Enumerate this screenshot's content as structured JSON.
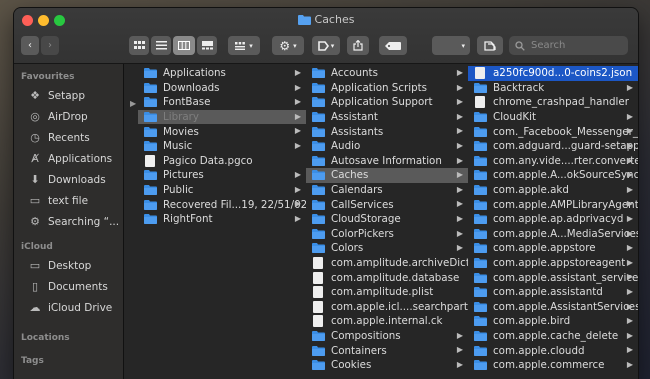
{
  "window": {
    "title": "Caches"
  },
  "toolbar": {
    "search_placeholder": "Search"
  },
  "sidebar": {
    "favourites_header": "Favourites",
    "favourites": [
      {
        "label": "Setapp",
        "icon": "setapp-icon"
      },
      {
        "label": "AirDrop",
        "icon": "airdrop-icon"
      },
      {
        "label": "Recents",
        "icon": "clock-icon"
      },
      {
        "label": "Applications",
        "icon": "applications-icon"
      },
      {
        "label": "Downloads",
        "icon": "download-icon"
      },
      {
        "label": "text file",
        "icon": "document-icon"
      },
      {
        "label": "Searching “...",
        "icon": "gear-icon"
      }
    ],
    "icloud_header": "iCloud",
    "icloud": [
      {
        "label": "Desktop",
        "icon": "desktop-icon"
      },
      {
        "label": "Documents",
        "icon": "document-icon"
      },
      {
        "label": "iCloud Drive",
        "icon": "cloud-icon"
      }
    ],
    "locations_header": "Locations",
    "tags_header": "Tags"
  },
  "columns": {
    "col1": [
      {
        "label": "Applications"
      },
      {
        "label": "Downloads"
      },
      {
        "label": "FontBase"
      },
      {
        "label": "Library"
      },
      {
        "label": "Movies"
      },
      {
        "label": "Music"
      },
      {
        "label": "Pagico Data.pgco"
      },
      {
        "label": "Pictures"
      },
      {
        "label": "Public"
      },
      {
        "label": "Recovered Fil...19, 22/51/02"
      },
      {
        "label": "RightFont"
      }
    ],
    "col2": [
      {
        "label": "Accounts"
      },
      {
        "label": "Application Scripts"
      },
      {
        "label": "Application Support"
      },
      {
        "label": "Assistant"
      },
      {
        "label": "Assistants"
      },
      {
        "label": "Audio"
      },
      {
        "label": "Autosave Information"
      },
      {
        "label": "Caches"
      },
      {
        "label": "Calendars"
      },
      {
        "label": "CallServices"
      },
      {
        "label": "CloudStorage"
      },
      {
        "label": "ColorPickers"
      },
      {
        "label": "Colors"
      },
      {
        "label": "com.amplitude.archiveDict"
      },
      {
        "label": "com.amplitude.database"
      },
      {
        "label": "com.amplitude.plist"
      },
      {
        "label": "com.apple.icl....searchpartyd"
      },
      {
        "label": "com.apple.internal.ck"
      },
      {
        "label": "Compositions"
      },
      {
        "label": "Containers"
      },
      {
        "label": "Cookies"
      }
    ],
    "col3": [
      {
        "label": "a250fc900d...0-coins2.json"
      },
      {
        "label": "Backtrack"
      },
      {
        "label": "chrome_crashpad_handler"
      },
      {
        "label": "CloudKit"
      },
      {
        "label": "com._Facebook_Messenger_"
      },
      {
        "label": "com.adguard...guard-setapp"
      },
      {
        "label": "com.any.vide....rter.converter"
      },
      {
        "label": "com.apple.A...okSourceSync"
      },
      {
        "label": "com.apple.akd"
      },
      {
        "label": "com.apple.AMPLibraryAgent"
      },
      {
        "label": "com.apple.ap.adprivacyd"
      },
      {
        "label": "com.apple.A...MediaServices"
      },
      {
        "label": "com.apple.appstore"
      },
      {
        "label": "com.apple.appstoreagent"
      },
      {
        "label": "com.apple.assistant_service"
      },
      {
        "label": "com.apple.assistantd"
      },
      {
        "label": "com.apple.AssistantServices"
      },
      {
        "label": "com.apple.bird"
      },
      {
        "label": "com.apple.cache_delete"
      },
      {
        "label": "com.apple.cloudd"
      },
      {
        "label": "com.apple.commerce"
      }
    ]
  },
  "colors": {
    "folder": "#3a8ee6",
    "selection": "#1c57c5",
    "highlight": "#5a5a5a"
  }
}
